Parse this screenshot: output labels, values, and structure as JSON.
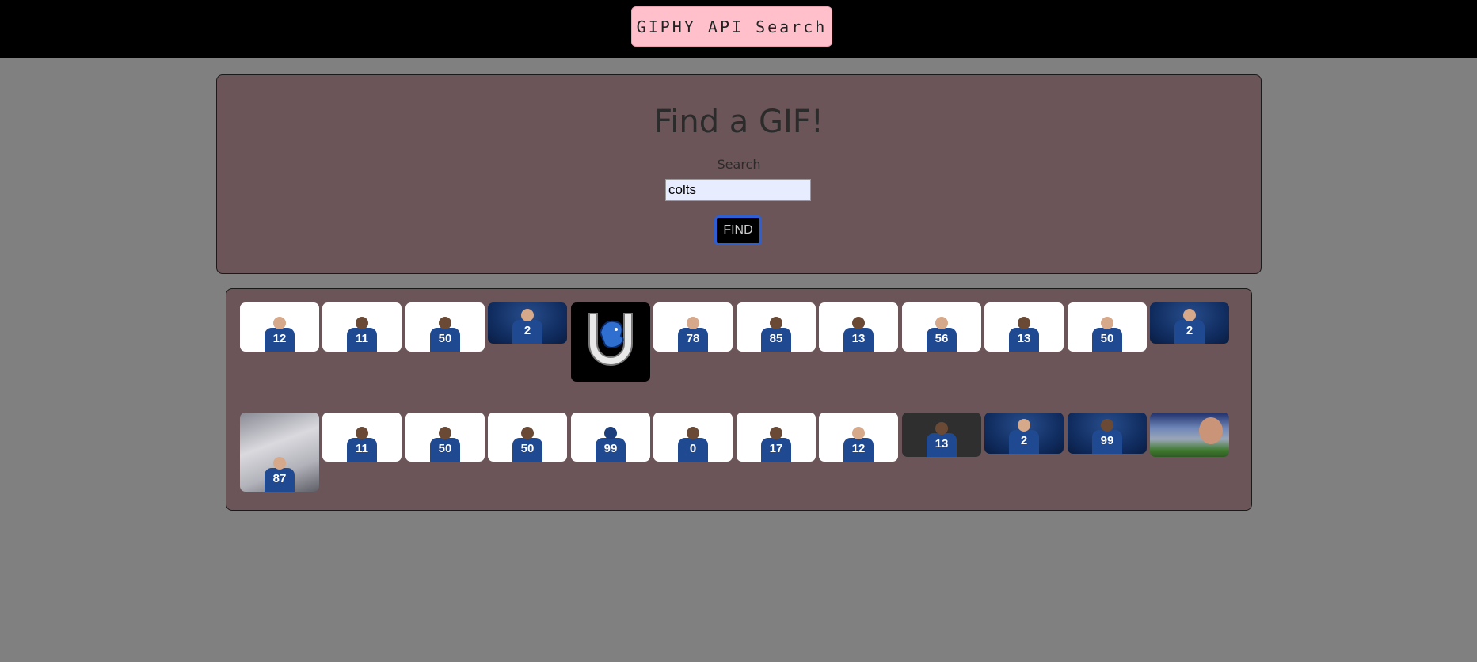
{
  "header": {
    "title": "GIPHY API Search"
  },
  "search": {
    "heading": "Find a GIF!",
    "label": "Search",
    "value": "colts",
    "button_label": "FIND"
  },
  "results": {
    "row1": [
      {
        "style": "white",
        "jersey": "12",
        "skin": "light"
      },
      {
        "style": "white",
        "jersey": "11",
        "skin": "dark"
      },
      {
        "style": "white",
        "jersey": "50",
        "skin": "dark"
      },
      {
        "style": "blue",
        "jersey": "2",
        "skin": "light"
      },
      {
        "style": "logo",
        "jersey": "",
        "skin": ""
      },
      {
        "style": "white",
        "jersey": "78",
        "skin": "light"
      },
      {
        "style": "white",
        "jersey": "85",
        "skin": "dark"
      },
      {
        "style": "white",
        "jersey": "13",
        "skin": "dark"
      },
      {
        "style": "white",
        "jersey": "56",
        "skin": "light"
      },
      {
        "style": "white",
        "jersey": "13",
        "skin": "dark"
      },
      {
        "style": "white",
        "jersey": "50",
        "skin": "light"
      },
      {
        "style": "blue",
        "jersey": "2",
        "skin": "light"
      }
    ],
    "row2": [
      {
        "style": "photo",
        "jersey": "87",
        "skin": "light"
      },
      {
        "style": "white",
        "jersey": "11",
        "skin": "dark"
      },
      {
        "style": "white",
        "jersey": "50",
        "skin": "dark"
      },
      {
        "style": "white",
        "jersey": "50",
        "skin": "dark"
      },
      {
        "style": "white",
        "jersey": "99",
        "skin": "helmet"
      },
      {
        "style": "white",
        "jersey": "0",
        "skin": "dark"
      },
      {
        "style": "white",
        "jersey": "17",
        "skin": "dark"
      },
      {
        "style": "white",
        "jersey": "12",
        "skin": "light"
      },
      {
        "style": "dark",
        "jersey": "13",
        "skin": "dark"
      },
      {
        "style": "blue",
        "jersey": "2",
        "skin": "light"
      },
      {
        "style": "blue",
        "jersey": "99",
        "skin": "dark"
      },
      {
        "style": "stadium",
        "jersey": "",
        "skin": ""
      }
    ]
  }
}
